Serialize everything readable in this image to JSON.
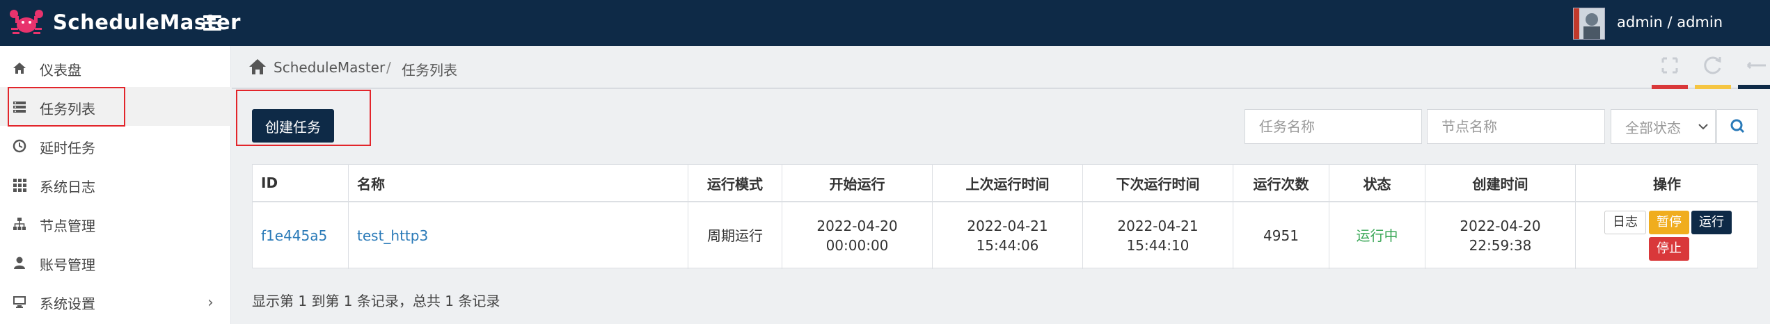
{
  "app": {
    "brand": "ScheduleMaster",
    "user": "admin / admin"
  },
  "icons": {
    "logo": "crab-logo-icon",
    "menu": "hamburger-icon",
    "home": "home-icon",
    "fullscreen": "fullscreen-icon",
    "refresh": "refresh-icon",
    "collapse": "collapse-icon",
    "search": "search-icon"
  },
  "colors": {
    "navy": "#0e2a47",
    "link": "#2a7ab8",
    "running": "#3aa757",
    "pause": "#f0ad1e",
    "stop": "#d9383a",
    "highlight": "#e2252b"
  },
  "sidebar": {
    "items": [
      {
        "label": "仪表盘",
        "icon": "home-icon"
      },
      {
        "label": "任务列表",
        "icon": "server-icon",
        "active": true
      },
      {
        "label": "延时任务",
        "icon": "clock-icon"
      },
      {
        "label": "系统日志",
        "icon": "grid-icon"
      },
      {
        "label": "节点管理",
        "icon": "sitemap-icon"
      },
      {
        "label": "账号管理",
        "icon": "user-icon"
      },
      {
        "label": "系统设置",
        "icon": "monitor-icon"
      }
    ],
    "chevron": "›"
  },
  "breadcrumb": {
    "root": "ScheduleMaster",
    "separator": "/",
    "current": "任务列表"
  },
  "toolbar": {
    "create_label": "创建任务",
    "task_name_placeholder": "任务名称",
    "node_name_placeholder": "节点名称",
    "status_selected": "全部状态"
  },
  "table": {
    "headers": [
      "ID",
      "名称",
      "运行模式",
      "开始运行",
      "上次运行时间",
      "下次运行时间",
      "运行次数",
      "状态",
      "创建时间",
      "操作"
    ],
    "rows": [
      {
        "id": "f1e445a5",
        "name": "test_http3",
        "mode": "周期运行",
        "start_date": "2022-04-20",
        "start_time": "00:00:00",
        "last_date": "2022-04-21",
        "last_time": "15:44:06",
        "next_date": "2022-04-21",
        "next_time": "15:44:10",
        "runs": "4951",
        "status": "运行中",
        "created_date": "2022-04-20",
        "created_time": "22:59:38",
        "actions": {
          "log": "日志",
          "pause": "暂停",
          "run": "运行",
          "stop": "停止"
        }
      }
    ]
  },
  "footer": {
    "info": "显示第 1 到第 1 条记录，总共 1 条记录"
  }
}
